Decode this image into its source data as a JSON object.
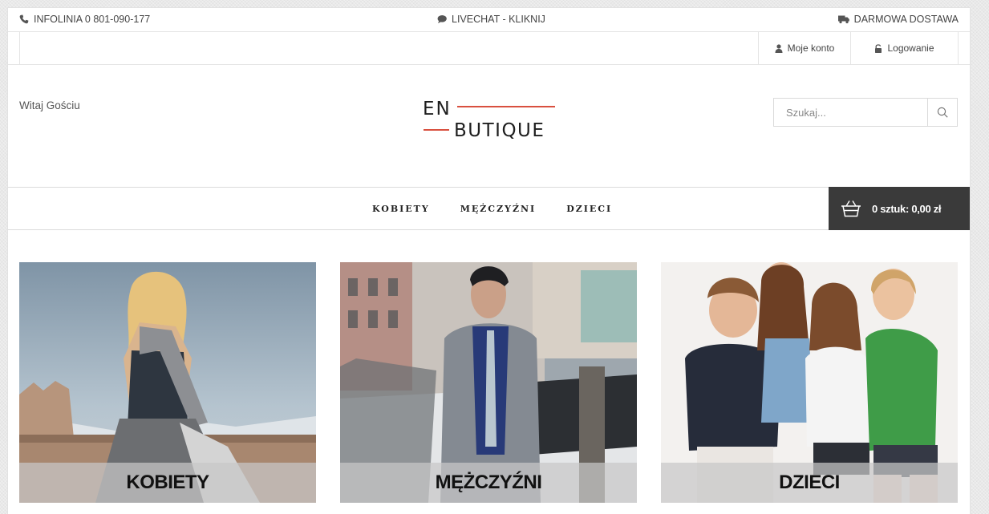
{
  "topbar": {
    "phone_icon": "phone-icon",
    "phone_text": "INFOLINIA 0 801-090-177",
    "chat_icon": "chat-bubble-icon",
    "chat_text": "LIVECHAT - KLIKNIJ",
    "truck_icon": "truck-icon",
    "shipping_text": "DARMOWA DOSTAWA"
  },
  "account": {
    "my_account_icon": "user-icon",
    "my_account_label": "Moje konto",
    "login_icon": "unlock-icon",
    "login_label": "Logowanie"
  },
  "header": {
    "welcome": "Witaj Gościu",
    "logo_line1": "EN",
    "logo_line2": "BUTIQUE",
    "logo_accent": "#d9503f",
    "search_placeholder": "Szukaj..."
  },
  "nav": {
    "items": [
      "KOBIETY",
      "MĘŻCZYŹNI",
      "DZIECI"
    ],
    "cart_label": "0 sztuk: 0,00 zł",
    "cart_bg": "#3a3a3a"
  },
  "categories": [
    {
      "label": "KOBIETY",
      "image": "woman-fashion-photo"
    },
    {
      "label": "MĘŻCZYŹNI",
      "image": "man-fashion-photo"
    },
    {
      "label": "DZIECI",
      "image": "kids-fashion-photo"
    }
  ]
}
